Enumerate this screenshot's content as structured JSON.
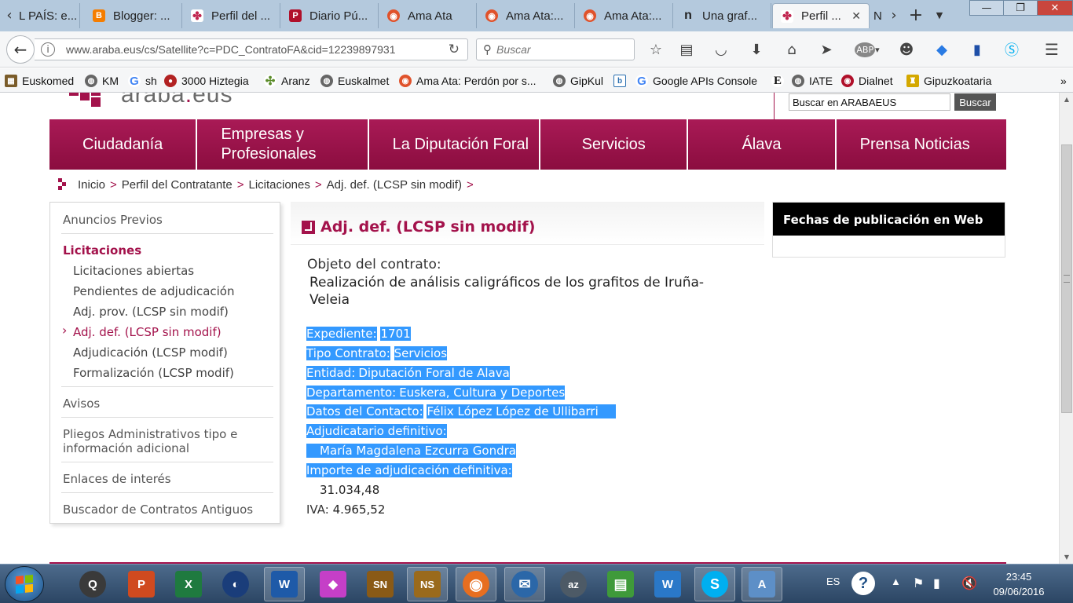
{
  "browser": {
    "tabs": [
      {
        "title": "L PAÍS: e...",
        "icon": "elpais-icon",
        "color": "#ffffff"
      },
      {
        "title": "Blogger: ...",
        "icon": "blogger-icon",
        "color": "#f57d00"
      },
      {
        "title": "Perfil del ...",
        "icon": "araba-icon",
        "color": "#c0254f"
      },
      {
        "title": "Diario Pú...",
        "icon": "diario-icon",
        "color": "#b0102a"
      },
      {
        "title": "Ama Ata",
        "icon": "amaata-icon",
        "color": "#e0522b"
      },
      {
        "title": "Ama Ata:...",
        "icon": "amaata-icon",
        "color": "#e0522b"
      },
      {
        "title": "Ama Ata:...",
        "icon": "amaata-icon",
        "color": "#e0522b"
      },
      {
        "title": "Una graf...",
        "icon": "n-icon",
        "color": "#222222"
      },
      {
        "title": "Perfil ...",
        "icon": "araba-icon",
        "color": "#c0254f",
        "active": true
      },
      {
        "title": "N",
        "icon": "",
        "color": ""
      }
    ],
    "new_tab": "+",
    "window_buttons": {
      "minimize": "—",
      "maximize": "❐",
      "close": "✕"
    },
    "url": "www.araba.eus/cs/Satellite?c=PDC_ContratoFA&cid=12239897931",
    "search_placeholder": "Buscar",
    "bookmarks": [
      {
        "label": "Euskomed",
        "color": "#7a5c2a"
      },
      {
        "label": "KM",
        "color": "#666666"
      },
      {
        "label": "sh",
        "color": "#4285f4"
      },
      {
        "label": "3000 Hiztegia",
        "color": "#b22222"
      },
      {
        "label": "Aranz",
        "color": "#5b8c2a"
      },
      {
        "label": "Euskalmet",
        "color": "#666666"
      },
      {
        "label": "Ama Ata: Perdón por s...",
        "color": "#e0522b"
      },
      {
        "label": "GipKul",
        "color": "#666666"
      },
      {
        "label": "",
        "color": "#2a6fb0"
      },
      {
        "label": "Google APIs Console",
        "color": "#4285f4"
      },
      {
        "label": "",
        "color": "#111111"
      },
      {
        "label": "IATE",
        "color": "#666666"
      },
      {
        "label": "Dialnet",
        "color": "#b0102a"
      },
      {
        "label": "Gipuzkoataria",
        "color": "#d4a800"
      }
    ]
  },
  "site": {
    "logo_text": "araba",
    "logo_dot": ".",
    "logo_tld": "eus",
    "search_value": "Buscar en ARABAEUS",
    "search_button": "Buscar",
    "nav": [
      "Ciudadanía",
      "Empresas y Profesionales",
      "La Diputación Foral",
      "Servicios",
      "Álava",
      "Prensa Noticias"
    ],
    "breadcrumb": [
      "Inicio",
      "Perfil del Contratante",
      "Licitaciones",
      "Adj. def. (LCSP sin modif)"
    ],
    "breadcrumb_sep": ">"
  },
  "sidebar": {
    "anuncios": "Anuncios Previos",
    "licitaciones": "Licitaciones",
    "sub": [
      {
        "label": "Licitaciones abiertas"
      },
      {
        "label": "Pendientes de adjudicación"
      },
      {
        "label": "Adj. prov. (LCSP sin modif)"
      },
      {
        "label": "Adj. def. (LCSP sin modif)",
        "active": true
      },
      {
        "label": "Adjudicación (LCSP modif)"
      },
      {
        "label": "Formalización (LCSP modif)"
      }
    ],
    "avisos": "Avisos",
    "pliegos_1": "Pliegos Administrativos tipo e",
    "pliegos_2": "información adicional",
    "enlaces": "Enlaces de interés",
    "buscador": "Buscador de Contratos Antiguos"
  },
  "content": {
    "title": "Adj. def. (LCSP sin modif)",
    "objeto_label": "Objeto del contrato:",
    "objeto_text": "Realización de análisis caligráficos de los grafitos de Iruña-Veleia",
    "expediente_label": "Expediente:",
    "expediente_value": "1701",
    "tipo_label": "Tipo Contrato:",
    "tipo_value": "Servicios",
    "entidad_label": "Entidad:",
    "entidad_value": "Diputación Foral de Alava",
    "departamento_label": "Departamento:",
    "departamento_value": "Euskera, Cultura y Deportes",
    "contacto_label": "Datos del Contacto:",
    "contacto_value": "Félix López López de Ullibarri",
    "adjudicatario_label": "Adjudicatario definitivo:",
    "adjudicatario_value": "María Magdalena Ezcurra Gondra",
    "importe_label": "Importe de adjudicación definitiva:",
    "importe_value": "31.034,48",
    "iva_label": "IVA:",
    "iva_value": "4.965,52"
  },
  "right_box": {
    "title": "Fechas de publicación en Web"
  },
  "taskbar": {
    "apps": [
      {
        "icon": "quicktime-icon",
        "glyph": "Q",
        "color": "#3a3a3a"
      },
      {
        "icon": "powerpoint-icon",
        "glyph": "P",
        "color": "#d04a1f"
      },
      {
        "icon": "excel-icon",
        "glyph": "X",
        "color": "#1f7a3f"
      },
      {
        "icon": "globe-icon",
        "glyph": "◐",
        "color": "#1a3d7a"
      },
      {
        "icon": "word-icon",
        "glyph": "W",
        "color": "#1e5aa8"
      },
      {
        "icon": "gem-icon",
        "glyph": "◆",
        "color": "#c53fc7"
      },
      {
        "icon": "sn-icon",
        "glyph": "SN",
        "color": "#8a5a16"
      },
      {
        "icon": "ns-icon",
        "glyph": "NS",
        "color": "#9a6a1c"
      },
      {
        "icon": "firefox-icon",
        "glyph": "◉",
        "color": "#e76e1f"
      },
      {
        "icon": "thunderbird-icon",
        "glyph": "✉",
        "color": "#2b67a8"
      },
      {
        "icon": "az-icon",
        "glyph": "az",
        "color": "#4d5a66"
      },
      {
        "icon": "notepad-icon",
        "glyph": "▤",
        "color": "#3f9a3a"
      },
      {
        "icon": "w-app-icon",
        "glyph": "W",
        "color": "#2a78c8"
      },
      {
        "icon": "skype-icon",
        "glyph": "S",
        "color": "#00aff0"
      },
      {
        "icon": "doc-icon",
        "glyph": "A",
        "color": "#5d8fc7"
      }
    ],
    "language": "ES",
    "time": "23:45",
    "date": "09/06/2016"
  }
}
